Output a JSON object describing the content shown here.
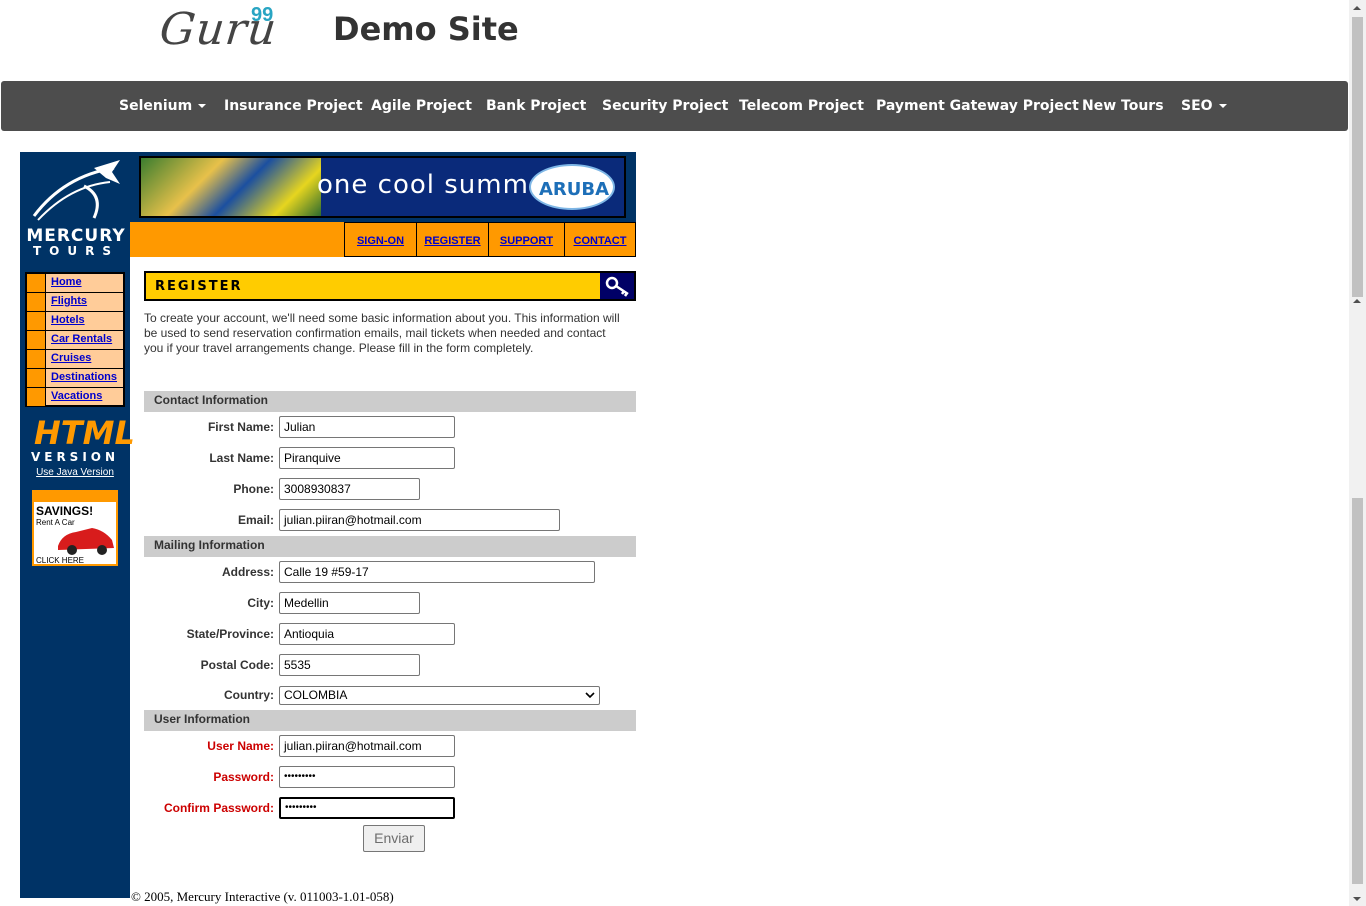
{
  "header": {
    "logo_text": "Guru",
    "logo_sup": "99",
    "site_title": "Demo Site"
  },
  "nav": {
    "items": [
      {
        "label": "Selenium",
        "has_caret": true
      },
      {
        "label": "Insurance Project",
        "has_caret": false
      },
      {
        "label": "Agile Project",
        "has_caret": false
      },
      {
        "label": "Bank Project",
        "has_caret": false
      },
      {
        "label": "Security Project",
        "has_caret": false
      },
      {
        "label": "Telecom Project",
        "has_caret": false
      },
      {
        "label": "Payment Gateway Project",
        "has_caret": false
      },
      {
        "label": "New Tours",
        "has_caret": false
      },
      {
        "label": "SEO",
        "has_caret": true
      }
    ]
  },
  "sidebar": {
    "brand": "MERCURY",
    "brand_sub": "TOURS",
    "menu": [
      "Home",
      "Flights",
      "Hotels",
      "Car Rentals",
      "Cruises",
      "Destinations",
      "Vacations"
    ],
    "html_badge": "HTML",
    "version_badge": "VERSION",
    "java_link": "Use Java Version",
    "ad": {
      "title": "SAVINGS!",
      "subtitle": "Rent A Car",
      "cta": "CLICK HERE"
    }
  },
  "banner": {
    "text": "one cool summer",
    "brand": "ARUBA"
  },
  "toplinks": [
    "SIGN-ON",
    "REGISTER",
    "SUPPORT",
    "CONTACT"
  ],
  "register": {
    "title": "REGISTER",
    "intro": "To create your account, we'll need some basic information about you. This information will be used to send reservation confirmation emails, mail tickets when needed and contact you if your travel arrangements change. Please fill in the form completely."
  },
  "sections": {
    "contact": "Contact Information",
    "mailing": "Mailing Information",
    "user": "User Information"
  },
  "form": {
    "first_name": {
      "label": "First Name:",
      "value": "Julian"
    },
    "last_name": {
      "label": "Last Name:",
      "value": "Piranquive"
    },
    "phone": {
      "label": "Phone:",
      "value": "3008930837"
    },
    "email": {
      "label": "Email:",
      "value": "julian.piiran@hotmail.com"
    },
    "address": {
      "label": "Address:",
      "value": "Calle 19 #59-17"
    },
    "city": {
      "label": "City:",
      "value": "Medellin"
    },
    "state": {
      "label": "State/Province:",
      "value": "Antioquia"
    },
    "postal": {
      "label": "Postal Code:",
      "value": "5535"
    },
    "country": {
      "label": "Country:",
      "value": "COLOMBIA"
    },
    "username": {
      "label": "User Name:",
      "value": "julian.piiran@hotmail.com"
    },
    "password": {
      "label": "Password:",
      "value": "•••••••••"
    },
    "confirm": {
      "label": "Confirm Password:",
      "value": "•••••••••"
    },
    "submit": "Enviar"
  },
  "footer": "© 2005, Mercury Interactive (v. 011003-1.01-058)",
  "colors": {
    "nav_bg": "#4d4d4d",
    "sidebar_bg": "#003366",
    "accent_orange": "#ff9900",
    "register_yellow": "#ffcc00",
    "required_red": "#cc0000",
    "link_blue": "#0000cc"
  }
}
